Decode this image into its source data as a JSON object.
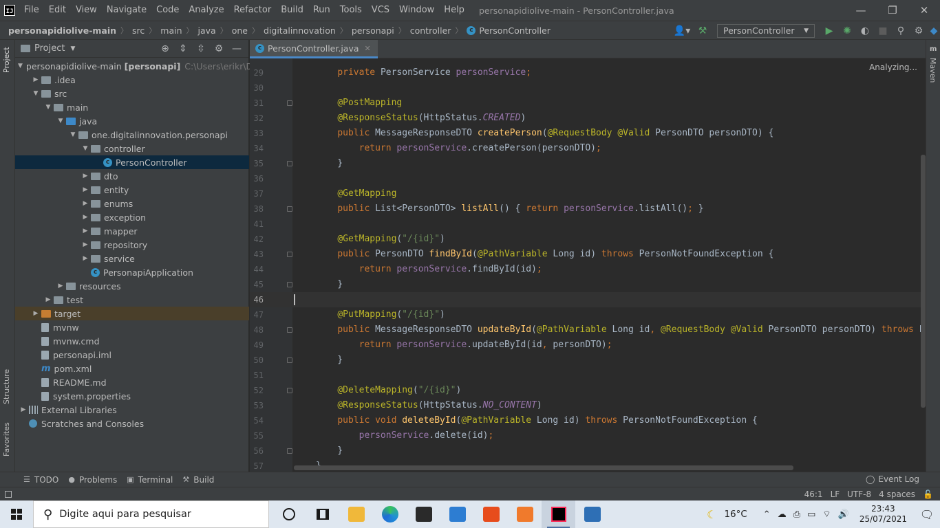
{
  "window": {
    "title": "personapidiolive-main - PersonController.java",
    "logo": "IJ"
  },
  "menu": [
    "File",
    "Edit",
    "View",
    "Navigate",
    "Code",
    "Analyze",
    "Refactor",
    "Build",
    "Run",
    "Tools",
    "VCS",
    "Window",
    "Help"
  ],
  "breadcrumbs": [
    "personapidiolive-main",
    "src",
    "main",
    "java",
    "one",
    "digitalinnovation",
    "personapi",
    "controller",
    "PersonController"
  ],
  "run_config": "PersonController",
  "project_panel": {
    "title": "Project",
    "tree": [
      {
        "depth": 0,
        "arrow": "down",
        "icon": "folder-src",
        "label": "personapidiolive-main",
        "bold_suffix": "[personapi]",
        "dim": "C:\\Users\\erikr\\Desktc"
      },
      {
        "depth": 1,
        "arrow": "right",
        "icon": "folder",
        "label": ".idea"
      },
      {
        "depth": 1,
        "arrow": "down",
        "icon": "folder",
        "label": "src"
      },
      {
        "depth": 2,
        "arrow": "down",
        "icon": "folder",
        "label": "main"
      },
      {
        "depth": 3,
        "arrow": "down",
        "icon": "folder-blue",
        "label": "java"
      },
      {
        "depth": 4,
        "arrow": "down",
        "icon": "folder",
        "label": "one.digitalinnovation.personapi"
      },
      {
        "depth": 5,
        "arrow": "down",
        "icon": "folder",
        "label": "controller"
      },
      {
        "depth": 6,
        "arrow": "",
        "icon": "class",
        "label": "PersonController",
        "selected": true
      },
      {
        "depth": 5,
        "arrow": "right",
        "icon": "folder",
        "label": "dto"
      },
      {
        "depth": 5,
        "arrow": "right",
        "icon": "folder",
        "label": "entity"
      },
      {
        "depth": 5,
        "arrow": "right",
        "icon": "folder",
        "label": "enums"
      },
      {
        "depth": 5,
        "arrow": "right",
        "icon": "folder",
        "label": "exception"
      },
      {
        "depth": 5,
        "arrow": "right",
        "icon": "folder",
        "label": "mapper"
      },
      {
        "depth": 5,
        "arrow": "right",
        "icon": "folder",
        "label": "repository"
      },
      {
        "depth": 5,
        "arrow": "right",
        "icon": "folder",
        "label": "service"
      },
      {
        "depth": 5,
        "arrow": "",
        "icon": "class",
        "label": "PersonapiApplication"
      },
      {
        "depth": 3,
        "arrow": "right",
        "icon": "folder",
        "label": "resources"
      },
      {
        "depth": 2,
        "arrow": "right",
        "icon": "folder",
        "label": "test"
      },
      {
        "depth": 1,
        "arrow": "right",
        "icon": "folder-orange",
        "label": "target",
        "excluded": true
      },
      {
        "depth": 1,
        "arrow": "",
        "icon": "file",
        "label": "mvnw"
      },
      {
        "depth": 1,
        "arrow": "",
        "icon": "file",
        "label": "mvnw.cmd"
      },
      {
        "depth": 1,
        "arrow": "",
        "icon": "file",
        "label": "personapi.iml"
      },
      {
        "depth": 1,
        "arrow": "",
        "icon": "maven",
        "label": "pom.xml"
      },
      {
        "depth": 1,
        "arrow": "",
        "icon": "file",
        "label": "README.md"
      },
      {
        "depth": 1,
        "arrow": "",
        "icon": "file",
        "label": "system.properties"
      },
      {
        "depth": 0,
        "arrow": "right",
        "icon": "library",
        "label": "External Libraries"
      },
      {
        "depth": 0,
        "arrow": "",
        "icon": "scratch",
        "label": "Scratches and Consoles"
      }
    ]
  },
  "left_stripe": [
    "Project",
    "Structure",
    "Favorites"
  ],
  "right_stripe": [
    "Maven"
  ],
  "editor": {
    "tab": "PersonController.java",
    "status": "Analyzing...",
    "lines": [
      {
        "n": "29",
        "html": "    <span class=\"k\">private </span>PersonService <span class=\"f\">personService</span><span class=\"k\">;</span>"
      },
      {
        "n": "30",
        "html": ""
      },
      {
        "n": "31",
        "fold": true,
        "html": "    <span class=\"a\">@PostMapping</span>"
      },
      {
        "n": "32",
        "html": "    <span class=\"a\">@ResponseStatus</span>(HttpStatus.<span class=\"fi\">CREATED</span>)"
      },
      {
        "n": "33",
        "html": "    <span class=\"k\">public </span>MessageResponseDTO <span class=\"m\">createPerson</span>(<span class=\"a\">@RequestBody @Valid </span>PersonDTO personDTO) {"
      },
      {
        "n": "34",
        "html": "        <span class=\"k\">return </span><span class=\"f\">personService</span>.createPerson(personDTO)<span class=\"k\">;</span>"
      },
      {
        "n": "35",
        "fold": true,
        "html": "    }"
      },
      {
        "n": "36",
        "html": ""
      },
      {
        "n": "37",
        "html": "    <span class=\"a\">@GetMapping</span>"
      },
      {
        "n": "38",
        "fold": true,
        "html": "    <span class=\"k\">public </span>List&lt;PersonDTO&gt; <span class=\"m\">listAll</span>() { <span class=\"k\">return </span><span class=\"f\">personService</span>.listAll()<span class=\"k\">;</span> }"
      },
      {
        "n": "41",
        "html": ""
      },
      {
        "n": "42",
        "html": "    <span class=\"a\">@GetMapping</span>(<span class=\"s\">\"/{id}\"</span>)"
      },
      {
        "n": "43",
        "fold": true,
        "html": "    <span class=\"k\">public </span>PersonDTO <span class=\"m\">findById</span>(<span class=\"a\">@PathVariable </span>Long id) <span class=\"k\">throws </span>PersonNotFoundException {"
      },
      {
        "n": "44",
        "html": "        <span class=\"k\">return </span><span class=\"f\">personService</span>.findById(id)<span class=\"k\">;</span>"
      },
      {
        "n": "45",
        "fold": true,
        "html": "    }"
      },
      {
        "n": "46",
        "current": true,
        "html": ""
      },
      {
        "n": "47",
        "html": "    <span class=\"a\">@PutMapping</span>(<span class=\"s\">\"/{id}\"</span>)"
      },
      {
        "n": "48",
        "fold": true,
        "html": "    <span class=\"k\">public </span>MessageResponseDTO <span class=\"m\">updateById</span>(<span class=\"a\">@PathVariable </span>Long id<span class=\"k\">, </span><span class=\"a\">@RequestBody @Valid </span>PersonDTO personDTO) <span class=\"k\">throws </span>Per"
      },
      {
        "n": "49",
        "html": "        <span class=\"k\">return </span><span class=\"f\">personService</span>.updateById(id<span class=\"k\">, </span>personDTO)<span class=\"k\">;</span>"
      },
      {
        "n": "50",
        "fold": true,
        "html": "    }"
      },
      {
        "n": "51",
        "html": ""
      },
      {
        "n": "52",
        "fold": true,
        "html": "    <span class=\"a\">@DeleteMapping</span>(<span class=\"s\">\"/{id}\"</span>)"
      },
      {
        "n": "53",
        "html": "    <span class=\"a\">@ResponseStatus</span>(HttpStatus.<span class=\"fi\">NO_CONTENT</span>)"
      },
      {
        "n": "54",
        "html": "    <span class=\"k\">public void </span><span class=\"m\">deleteById</span>(<span class=\"a\">@PathVariable </span>Long id) <span class=\"k\">throws </span>PersonNotFoundException {"
      },
      {
        "n": "55",
        "html": "        <span class=\"f\">personService</span>.delete(id)<span class=\"k\">;</span>"
      },
      {
        "n": "56",
        "fold": true,
        "html": "    }"
      },
      {
        "n": "57",
        "html": "}"
      }
    ]
  },
  "bottom_tools": [
    {
      "icon": "list-icon",
      "glyph": "☰",
      "label": "TODO"
    },
    {
      "icon": "problems-icon",
      "glyph": "●",
      "label": "Problems"
    },
    {
      "icon": "terminal-icon",
      "glyph": "▣",
      "label": "Terminal"
    },
    {
      "icon": "build-icon",
      "glyph": "⚒",
      "label": "Build"
    }
  ],
  "event_log": "Event Log",
  "status": {
    "position": "46:1",
    "line_sep": "LF",
    "encoding": "UTF-8",
    "indent": "4 spaces"
  },
  "taskbar": {
    "search_placeholder": "Digite aqui para pesquisar",
    "temperature": "16°C",
    "time": "23:43",
    "date": "25/07/2021",
    "apps": [
      {
        "name": "cortana-icon",
        "color": "#1a1a1a"
      },
      {
        "name": "task-view-icon",
        "color": "#1a1a1a"
      },
      {
        "name": "file-explorer-icon",
        "color": "#f0b83a"
      },
      {
        "name": "edge-icon",
        "color": "#1f8fd6"
      },
      {
        "name": "store-icon",
        "color": "#2a2a2a"
      },
      {
        "name": "mail-icon",
        "color": "#2d7dd2"
      },
      {
        "name": "office-icon",
        "color": "#e74c1c"
      },
      {
        "name": "xampp-icon",
        "color": "#f07a2c"
      },
      {
        "name": "intellij-icon",
        "color": "#000000",
        "active": true
      },
      {
        "name": "virtualbox-icon",
        "color": "#2e6fb5"
      }
    ]
  }
}
